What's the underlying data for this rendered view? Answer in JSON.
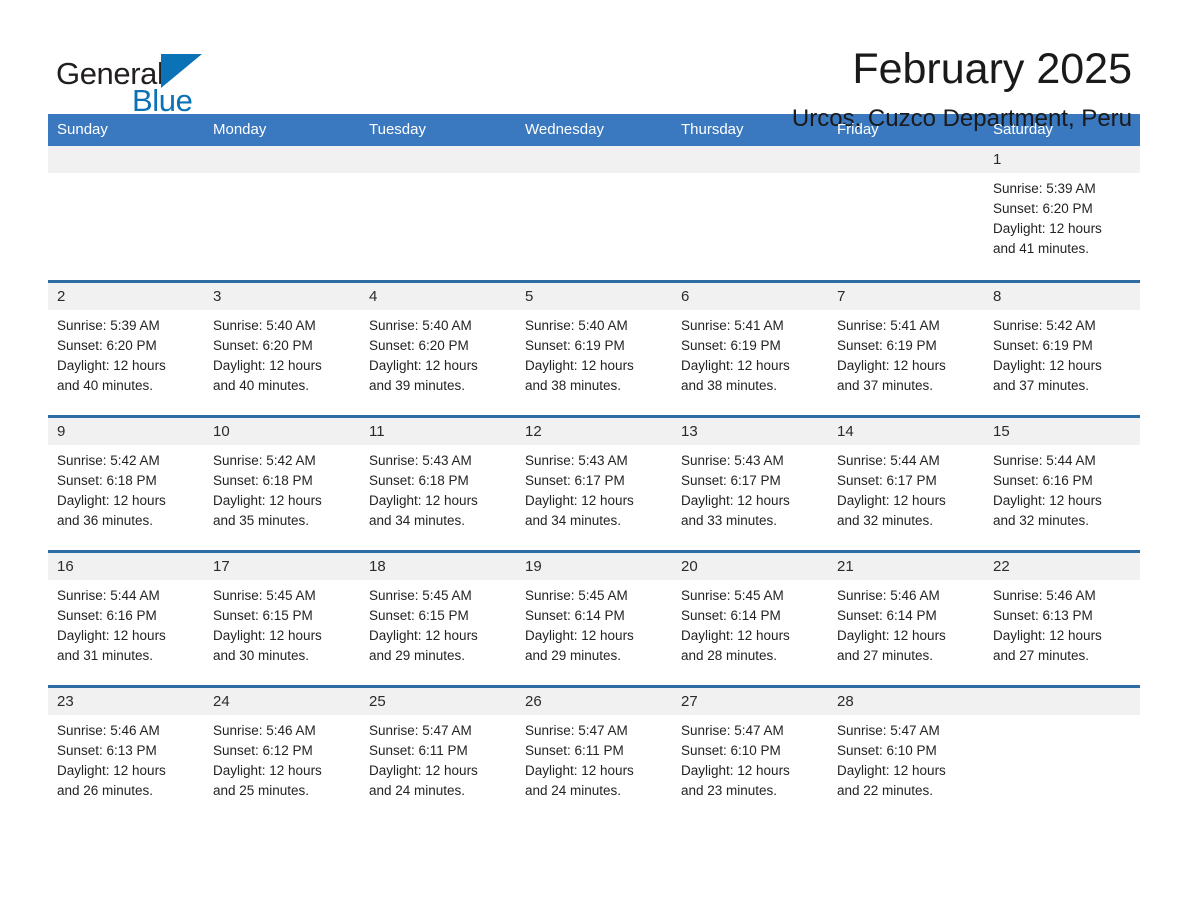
{
  "brand": {
    "word_general": "General",
    "word_blue": "Blue",
    "triangle_color": "#0b72b5"
  },
  "header": {
    "month_title": "February 2025",
    "location": "Urcos, Cuzco Department, Peru"
  },
  "theme": {
    "header_bg": "#3a78bf",
    "row_divider": "#2e6da4",
    "daynum_bg": "#f1f1f1",
    "text": "#232323"
  },
  "weekdays": [
    "Sunday",
    "Monday",
    "Tuesday",
    "Wednesday",
    "Thursday",
    "Friday",
    "Saturday"
  ],
  "weeks": [
    [
      {
        "day": "",
        "blank": true
      },
      {
        "day": "",
        "blank": true
      },
      {
        "day": "",
        "blank": true
      },
      {
        "day": "",
        "blank": true
      },
      {
        "day": "",
        "blank": true
      },
      {
        "day": "",
        "blank": true
      },
      {
        "day": "1",
        "sunrise": "Sunrise: 5:39 AM",
        "sunset": "Sunset: 6:20 PM",
        "daylight1": "Daylight: 12 hours",
        "daylight2": "and 41 minutes."
      }
    ],
    [
      {
        "day": "2",
        "sunrise": "Sunrise: 5:39 AM",
        "sunset": "Sunset: 6:20 PM",
        "daylight1": "Daylight: 12 hours",
        "daylight2": "and 40 minutes."
      },
      {
        "day": "3",
        "sunrise": "Sunrise: 5:40 AM",
        "sunset": "Sunset: 6:20 PM",
        "daylight1": "Daylight: 12 hours",
        "daylight2": "and 40 minutes."
      },
      {
        "day": "4",
        "sunrise": "Sunrise: 5:40 AM",
        "sunset": "Sunset: 6:20 PM",
        "daylight1": "Daylight: 12 hours",
        "daylight2": "and 39 minutes."
      },
      {
        "day": "5",
        "sunrise": "Sunrise: 5:40 AM",
        "sunset": "Sunset: 6:19 PM",
        "daylight1": "Daylight: 12 hours",
        "daylight2": "and 38 minutes."
      },
      {
        "day": "6",
        "sunrise": "Sunrise: 5:41 AM",
        "sunset": "Sunset: 6:19 PM",
        "daylight1": "Daylight: 12 hours",
        "daylight2": "and 38 minutes."
      },
      {
        "day": "7",
        "sunrise": "Sunrise: 5:41 AM",
        "sunset": "Sunset: 6:19 PM",
        "daylight1": "Daylight: 12 hours",
        "daylight2": "and 37 minutes."
      },
      {
        "day": "8",
        "sunrise": "Sunrise: 5:42 AM",
        "sunset": "Sunset: 6:19 PM",
        "daylight1": "Daylight: 12 hours",
        "daylight2": "and 37 minutes."
      }
    ],
    [
      {
        "day": "9",
        "sunrise": "Sunrise: 5:42 AM",
        "sunset": "Sunset: 6:18 PM",
        "daylight1": "Daylight: 12 hours",
        "daylight2": "and 36 minutes."
      },
      {
        "day": "10",
        "sunrise": "Sunrise: 5:42 AM",
        "sunset": "Sunset: 6:18 PM",
        "daylight1": "Daylight: 12 hours",
        "daylight2": "and 35 minutes."
      },
      {
        "day": "11",
        "sunrise": "Sunrise: 5:43 AM",
        "sunset": "Sunset: 6:18 PM",
        "daylight1": "Daylight: 12 hours",
        "daylight2": "and 34 minutes."
      },
      {
        "day": "12",
        "sunrise": "Sunrise: 5:43 AM",
        "sunset": "Sunset: 6:17 PM",
        "daylight1": "Daylight: 12 hours",
        "daylight2": "and 34 minutes."
      },
      {
        "day": "13",
        "sunrise": "Sunrise: 5:43 AM",
        "sunset": "Sunset: 6:17 PM",
        "daylight1": "Daylight: 12 hours",
        "daylight2": "and 33 minutes."
      },
      {
        "day": "14",
        "sunrise": "Sunrise: 5:44 AM",
        "sunset": "Sunset: 6:17 PM",
        "daylight1": "Daylight: 12 hours",
        "daylight2": "and 32 minutes."
      },
      {
        "day": "15",
        "sunrise": "Sunrise: 5:44 AM",
        "sunset": "Sunset: 6:16 PM",
        "daylight1": "Daylight: 12 hours",
        "daylight2": "and 32 minutes."
      }
    ],
    [
      {
        "day": "16",
        "sunrise": "Sunrise: 5:44 AM",
        "sunset": "Sunset: 6:16 PM",
        "daylight1": "Daylight: 12 hours",
        "daylight2": "and 31 minutes."
      },
      {
        "day": "17",
        "sunrise": "Sunrise: 5:45 AM",
        "sunset": "Sunset: 6:15 PM",
        "daylight1": "Daylight: 12 hours",
        "daylight2": "and 30 minutes."
      },
      {
        "day": "18",
        "sunrise": "Sunrise: 5:45 AM",
        "sunset": "Sunset: 6:15 PM",
        "daylight1": "Daylight: 12 hours",
        "daylight2": "and 29 minutes."
      },
      {
        "day": "19",
        "sunrise": "Sunrise: 5:45 AM",
        "sunset": "Sunset: 6:14 PM",
        "daylight1": "Daylight: 12 hours",
        "daylight2": "and 29 minutes."
      },
      {
        "day": "20",
        "sunrise": "Sunrise: 5:45 AM",
        "sunset": "Sunset: 6:14 PM",
        "daylight1": "Daylight: 12 hours",
        "daylight2": "and 28 minutes."
      },
      {
        "day": "21",
        "sunrise": "Sunrise: 5:46 AM",
        "sunset": "Sunset: 6:14 PM",
        "daylight1": "Daylight: 12 hours",
        "daylight2": "and 27 minutes."
      },
      {
        "day": "22",
        "sunrise": "Sunrise: 5:46 AM",
        "sunset": "Sunset: 6:13 PM",
        "daylight1": "Daylight: 12 hours",
        "daylight2": "and 27 minutes."
      }
    ],
    [
      {
        "day": "23",
        "sunrise": "Sunrise: 5:46 AM",
        "sunset": "Sunset: 6:13 PM",
        "daylight1": "Daylight: 12 hours",
        "daylight2": "and 26 minutes."
      },
      {
        "day": "24",
        "sunrise": "Sunrise: 5:46 AM",
        "sunset": "Sunset: 6:12 PM",
        "daylight1": "Daylight: 12 hours",
        "daylight2": "and 25 minutes."
      },
      {
        "day": "25",
        "sunrise": "Sunrise: 5:47 AM",
        "sunset": "Sunset: 6:11 PM",
        "daylight1": "Daylight: 12 hours",
        "daylight2": "and 24 minutes."
      },
      {
        "day": "26",
        "sunrise": "Sunrise: 5:47 AM",
        "sunset": "Sunset: 6:11 PM",
        "daylight1": "Daylight: 12 hours",
        "daylight2": "and 24 minutes."
      },
      {
        "day": "27",
        "sunrise": "Sunrise: 5:47 AM",
        "sunset": "Sunset: 6:10 PM",
        "daylight1": "Daylight: 12 hours",
        "daylight2": "and 23 minutes."
      },
      {
        "day": "28",
        "sunrise": "Sunrise: 5:47 AM",
        "sunset": "Sunset: 6:10 PM",
        "daylight1": "Daylight: 12 hours",
        "daylight2": "and 22 minutes."
      },
      {
        "day": "",
        "blank": true
      }
    ]
  ]
}
